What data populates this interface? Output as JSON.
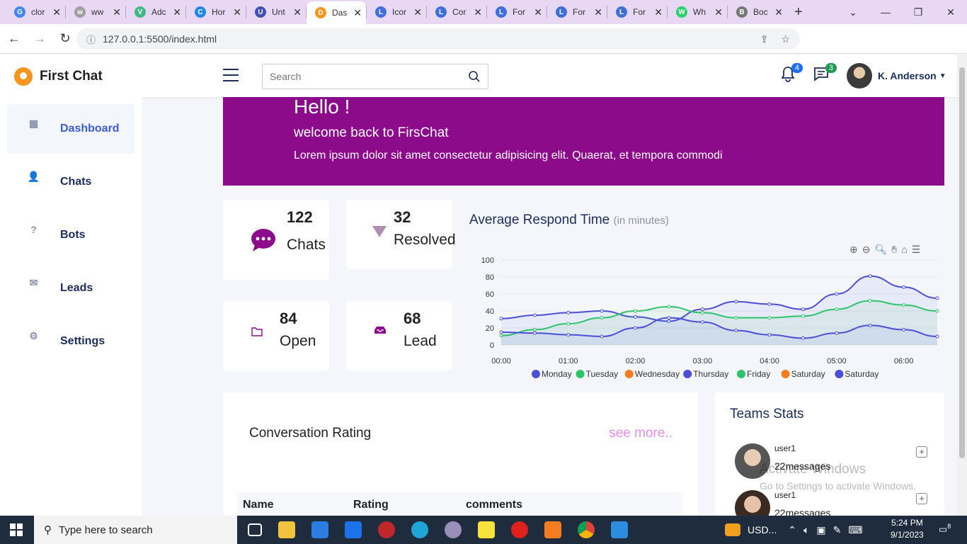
{
  "browser": {
    "tabs": [
      {
        "title": "clor",
        "fav_color": "#4285f4",
        "fav_glyph": "G"
      },
      {
        "title": "ww",
        "fav_color": "#9e9e9e",
        "fav_glyph": "w"
      },
      {
        "title": "Adc",
        "fav_color": "#41b883",
        "fav_glyph": "V"
      },
      {
        "title": "Hor",
        "fav_color": "#1e88e5",
        "fav_glyph": "C"
      },
      {
        "title": "Unt",
        "fav_color": "#3f51b5",
        "fav_glyph": "U"
      },
      {
        "title": "Das",
        "fav_color": "#f7941d",
        "fav_glyph": "D",
        "active": true
      },
      {
        "title": "Icor",
        "fav_color": "#3f6fd8",
        "fav_glyph": "L"
      },
      {
        "title": "Cor",
        "fav_color": "#3f6fd8",
        "fav_glyph": "L"
      },
      {
        "title": "For",
        "fav_color": "#3f6fd8",
        "fav_glyph": "L"
      },
      {
        "title": "For",
        "fav_color": "#3f6fd8",
        "fav_glyph": "L"
      },
      {
        "title": "For",
        "fav_color": "#3f6fd8",
        "fav_glyph": "L"
      },
      {
        "title": "Wh",
        "fav_color": "#25d366",
        "fav_glyph": "W"
      },
      {
        "title": "Boc",
        "fav_color": "#757575",
        "fav_glyph": "B"
      }
    ],
    "url": "127.0.0.1:5500/index.html"
  },
  "header": {
    "brand": "First Chat",
    "search_placeholder": "Search",
    "notifications_count": "4",
    "messages_count": "3",
    "user_name": "K. Anderson"
  },
  "sidebar": {
    "items": [
      {
        "label": "Dashboard",
        "icon": "grid-icon",
        "glyph": "▦",
        "active": true
      },
      {
        "label": "Chats",
        "icon": "user-icon",
        "glyph": "👤"
      },
      {
        "label": "Bots",
        "icon": "help-circle-icon",
        "glyph": "?"
      },
      {
        "label": "Leads",
        "icon": "mail-icon",
        "glyph": "✉"
      },
      {
        "label": "Settings",
        "icon": "gear-icon",
        "glyph": "⚙"
      }
    ]
  },
  "hero": {
    "title": "Hello !",
    "subtitle": "welcome back to FirsChat",
    "text": "Lorem ipsum dolor sit amet consectetur adipisicing elit. Quaerat, et tempora commodi"
  },
  "stats": {
    "chats": {
      "value": "122",
      "label": "Chats"
    },
    "resolved": {
      "value": "32",
      "label": "Resolved"
    },
    "open": {
      "value": "84",
      "label": "Open"
    },
    "lead": {
      "value": "68",
      "label": "Lead"
    }
  },
  "chart_title": "Average Respond Time",
  "chart_unit": "(in minutes)",
  "chart_data": {
    "type": "area",
    "x": [
      "00:00",
      "00:30",
      "01:00",
      "01:30",
      "02:00",
      "02:30",
      "03:00",
      "03:30",
      "04:00",
      "04:30",
      "05:00",
      "05:30",
      "06:00",
      "06:30"
    ],
    "x_ticks": [
      "00:00",
      "01:00",
      "02:00",
      "03:00",
      "04:00",
      "05:00",
      "06:00"
    ],
    "ylim": [
      0,
      100
    ],
    "y_ticks": [
      0,
      20,
      40,
      60,
      80,
      100
    ],
    "series": [
      {
        "name": "Monday",
        "color": "#4c4fd8",
        "values": [
          31,
          35,
          38,
          40,
          33,
          28,
          42,
          51,
          48,
          42,
          60,
          81,
          68,
          55
        ]
      },
      {
        "name": "Tuesday",
        "color": "#2ec46a",
        "values": [
          11,
          18,
          25,
          32,
          40,
          45,
          38,
          32,
          32,
          34,
          42,
          52,
          47,
          40
        ]
      },
      {
        "name": "Wednesday",
        "color": "#f57c1f",
        "values": []
      },
      {
        "name": "Thursday",
        "color": "#4c4fd8",
        "values": [
          15,
          14,
          12,
          10,
          20,
          32,
          27,
          17,
          12,
          8,
          14,
          23,
          18,
          10
        ]
      },
      {
        "name": "Friday",
        "color": "#2ec46a",
        "values": []
      },
      {
        "name": "Saturday",
        "color": "#f57c1f",
        "values": []
      },
      {
        "name": "Saturday",
        "color": "#4c4fd8",
        "values": []
      }
    ]
  },
  "conversation": {
    "title": "Conversation Rating",
    "see_more": "see more..",
    "columns": [
      "Name",
      "Rating",
      "comments"
    ]
  },
  "teams": {
    "title": "Teams Stats",
    "members": [
      {
        "name": "user1",
        "messages": "22messages"
      },
      {
        "name": "user1",
        "messages": "22messages"
      }
    ]
  },
  "watermark": {
    "line1": "Activate Windows",
    "line2": "Go to Settings to activate Windows."
  },
  "taskbar": {
    "search_placeholder": "Type here to search",
    "weather": "USD...",
    "time": "5:24 PM",
    "date": "9/1/2023",
    "notifications": "8"
  }
}
